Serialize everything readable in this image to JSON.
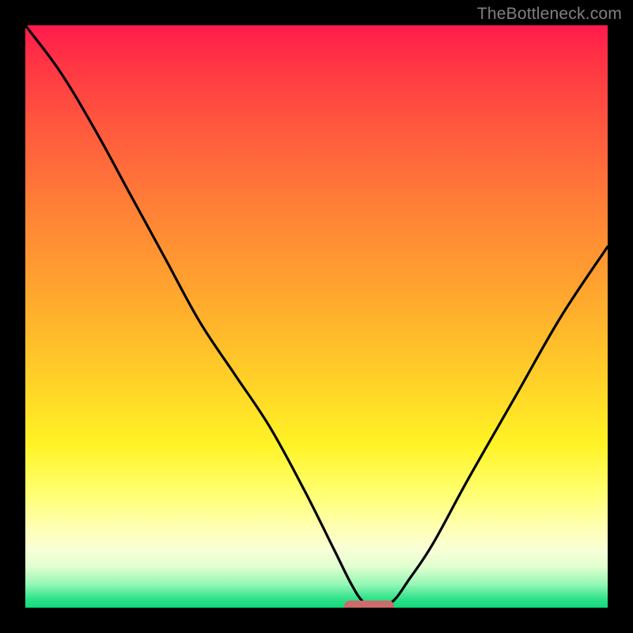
{
  "watermark": "TheBottleneck.com",
  "colors": {
    "frame": "#000000",
    "watermark": "#808080",
    "curve": "#000000",
    "marker": "#cc6b6b"
  },
  "chart_data": {
    "type": "line",
    "title": "",
    "xlabel": "",
    "ylabel": "",
    "xlim": [
      0,
      100
    ],
    "ylim": [
      0,
      100
    ],
    "series": [
      {
        "name": "bottleneck-curve",
        "x": [
          0,
          6,
          12,
          18,
          24,
          30,
          36,
          42,
          48,
          53,
          56,
          58,
          60,
          63,
          66,
          70,
          76,
          84,
          92,
          100
        ],
        "values": [
          100,
          92,
          82,
          71,
          60,
          49,
          40,
          31,
          20,
          10,
          4,
          1,
          0,
          1,
          5,
          11,
          22,
          36,
          50,
          62
        ]
      }
    ],
    "marker": {
      "x": 59,
      "y": 0,
      "width_pct": 8.5,
      "height_pct": 2
    },
    "gradient_stops": [
      {
        "pct": 0,
        "color": "#ff1a4d"
      },
      {
        "pct": 6,
        "color": "#ff3344"
      },
      {
        "pct": 18,
        "color": "#ff5a3e"
      },
      {
        "pct": 32,
        "color": "#ff8236"
      },
      {
        "pct": 46,
        "color": "#ffa62e"
      },
      {
        "pct": 60,
        "color": "#ffce28"
      },
      {
        "pct": 72,
        "color": "#fff326"
      },
      {
        "pct": 80,
        "color": "#ffff6e"
      },
      {
        "pct": 86,
        "color": "#ffffb0"
      },
      {
        "pct": 90,
        "color": "#f9ffd6"
      },
      {
        "pct": 93,
        "color": "#e0ffd0"
      },
      {
        "pct": 96,
        "color": "#94f7b5"
      },
      {
        "pct": 98.5,
        "color": "#2ee28a"
      },
      {
        "pct": 100,
        "color": "#12d87b"
      }
    ]
  }
}
